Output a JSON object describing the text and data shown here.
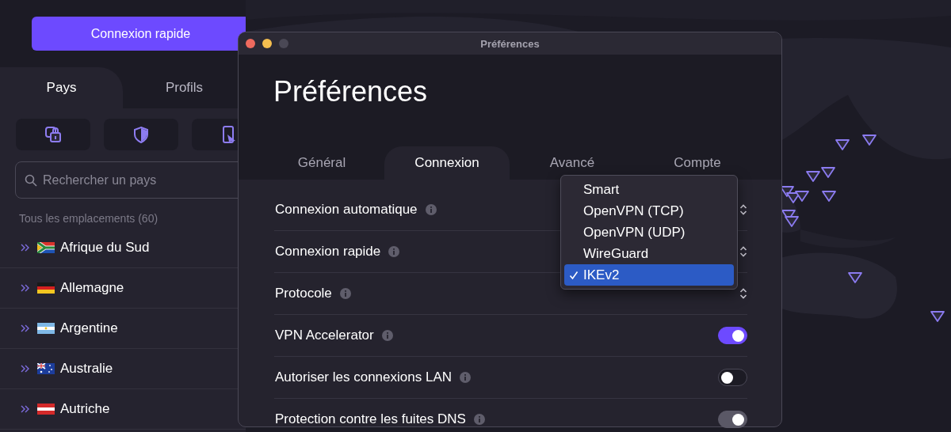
{
  "sidebar": {
    "quick_connect": "Connexion rapide",
    "tabs": [
      {
        "label": "Pays",
        "selected": true
      },
      {
        "label": "Profils",
        "selected": false
      }
    ],
    "search": {
      "placeholder": "Rechercher un pays"
    },
    "section_label": "Tous les emplacements (60)",
    "countries": [
      {
        "name": "Afrique du Sud"
      },
      {
        "name": "Allemagne"
      },
      {
        "name": "Argentine"
      },
      {
        "name": "Australie"
      },
      {
        "name": "Autriche"
      }
    ]
  },
  "window": {
    "title": "Préférences",
    "heading": "Préférences",
    "tabs": [
      {
        "label": "Général",
        "selected": false
      },
      {
        "label": "Connexion",
        "selected": true
      },
      {
        "label": "Avancé",
        "selected": false
      },
      {
        "label": "Compte",
        "selected": false
      }
    ],
    "settings": [
      {
        "label": "Connexion automatique",
        "kind": "select"
      },
      {
        "label": "Connexion rapide",
        "kind": "select"
      },
      {
        "label": "Protocole",
        "kind": "select"
      },
      {
        "label": "VPN Accelerator",
        "kind": "toggle",
        "on": true,
        "disabled": false
      },
      {
        "label": "Autoriser les connexions LAN",
        "kind": "toggle",
        "on": false,
        "disabled": false
      },
      {
        "label": "Protection contre les fuites DNS",
        "kind": "toggle",
        "on": true,
        "disabled": true
      }
    ],
    "dropdown": {
      "options": [
        {
          "label": "Smart",
          "selected": false
        },
        {
          "label": "OpenVPN (TCP)",
          "selected": false
        },
        {
          "label": "OpenVPN (UDP)",
          "selected": false
        },
        {
          "label": "WireGuard",
          "selected": false
        },
        {
          "label": "IKEv2",
          "selected": true
        }
      ]
    }
  }
}
